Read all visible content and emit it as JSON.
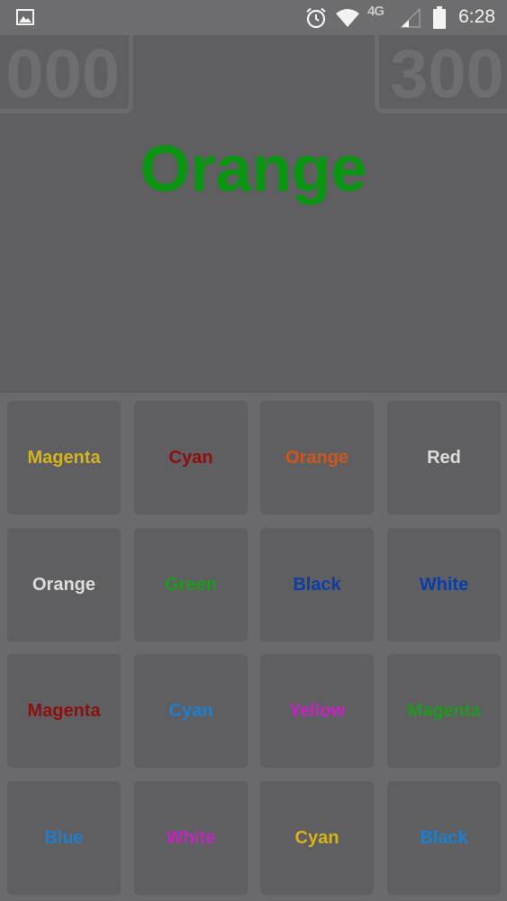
{
  "status_bar": {
    "time": "6:28",
    "network": "4G",
    "icons": [
      "image-icon",
      "alarm-icon",
      "wifi-icon",
      "signal-icon",
      "battery-icon"
    ]
  },
  "scores": {
    "left": "000",
    "right": "300"
  },
  "target": {
    "word": "Orange",
    "color": "#0a9612"
  },
  "tiles": [
    {
      "label": "Magenta",
      "color": "#d4b31e"
    },
    {
      "label": "Cyan",
      "color": "#8c1010"
    },
    {
      "label": "Orange",
      "color": "#d0561a"
    },
    {
      "label": "Red",
      "color": "#dcdcdc"
    },
    {
      "label": "Orange",
      "color": "#dcdcdc"
    },
    {
      "label": "Green",
      "color": "#1f9a1f"
    },
    {
      "label": "Black",
      "color": "#0d3ea5"
    },
    {
      "label": "White",
      "color": "#0d3ea5"
    },
    {
      "label": "Magenta",
      "color": "#8c1010"
    },
    {
      "label": "Cyan",
      "color": "#1d7fcf"
    },
    {
      "label": "Yellow",
      "color": "#c524c3"
    },
    {
      "label": "Magenta",
      "color": "#1f9a1f"
    },
    {
      "label": "Blue",
      "color": "#1d7fcf"
    },
    {
      "label": "White",
      "color": "#c524c3"
    },
    {
      "label": "Cyan",
      "color": "#d4b31e"
    },
    {
      "label": "Black",
      "color": "#1d7fcf"
    }
  ]
}
